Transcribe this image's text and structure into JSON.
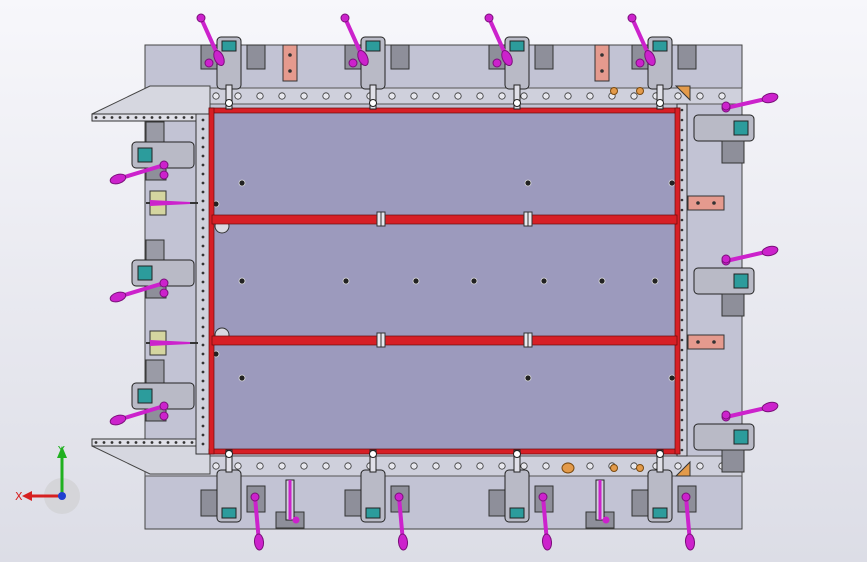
{
  "viewport": {
    "background_top": "#f7f7fb",
    "background_bottom": "#dcdde6"
  },
  "fixture": {
    "base_plate_color": "#c2c3d4",
    "panel_fill_color": "#9c9abd",
    "frame_color": "#d71f26",
    "handle_color": "#cc22cc",
    "clamp_body_color": "#b9bac6",
    "clamp_block_color": "#8e8f9a",
    "copper_pad_color": "#e59a8e",
    "orange_marker_color": "#e39a4a"
  },
  "triad": {
    "x_label": "X",
    "y_label": "Y",
    "x_color": "#d62020",
    "y_color": "#20b020",
    "z_color": "#2040d0"
  }
}
